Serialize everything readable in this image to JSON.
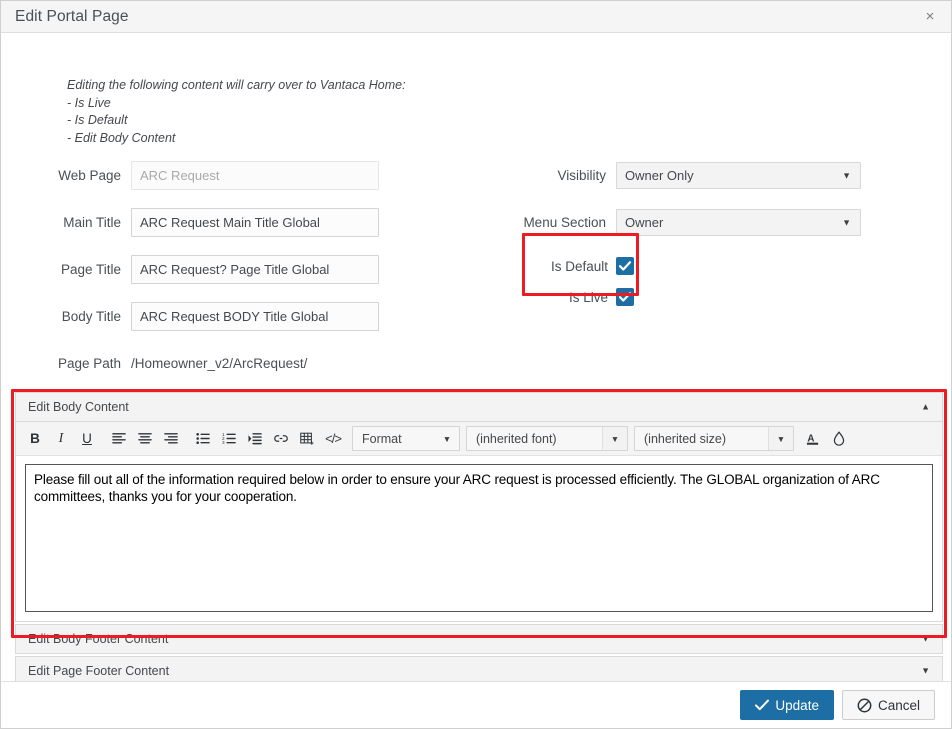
{
  "window": {
    "title": "Edit Portal Page",
    "close_label": "×"
  },
  "notes": {
    "heading": "Editing the following content will carry over to Vantaca Home:",
    "line1": "- Is Live",
    "line2": "- Is Default",
    "line3": "- Edit Body Content"
  },
  "form": {
    "web_page": {
      "label": "Web Page",
      "value": "ARC Request",
      "readonly": true
    },
    "main_title": {
      "label": "Main Title",
      "value": "ARC Request Main Title Global"
    },
    "page_title": {
      "label": "Page Title",
      "value": "ARC Request? Page Title Global"
    },
    "body_title": {
      "label": "Body Title",
      "value": "ARC Request BODY Title Global"
    },
    "page_path": {
      "label": "Page Path",
      "value": "/Homeowner_v2/ArcRequest/"
    },
    "visibility": {
      "label": "Visibility",
      "value": "Owner Only"
    },
    "menu_section": {
      "label": "Menu Section",
      "value": "Owner"
    },
    "is_default": {
      "label": "Is Default",
      "checked": true
    },
    "is_live": {
      "label": "Is Live",
      "checked": true
    }
  },
  "accordions": {
    "body_content": {
      "label": "Edit Body Content",
      "expanded": true,
      "caret": "▲"
    },
    "body_footer_content": {
      "label": "Edit Body Footer Content",
      "expanded": false,
      "caret": "▼"
    },
    "page_footer_content": {
      "label": "Edit Page Footer Content",
      "expanded": false,
      "caret": "▼"
    }
  },
  "editor": {
    "toolbar": {
      "bold": "B",
      "italic": "I",
      "underline": "U",
      "align_left": "align-left-icon",
      "align_center": "align-center-icon",
      "align_right": "align-right-icon",
      "bullet_list": "bullet-list-icon",
      "numbered_list": "numbered-list-icon",
      "indent": "indent-icon",
      "link": "link-icon",
      "table": "table-icon",
      "source_code": "</>",
      "format_select": "Format",
      "font_select": "(inherited font)",
      "size_select": "(inherited size)",
      "text_color": "A",
      "background_color": "droplet-icon",
      "caret": "▼"
    },
    "content": "Please fill out all of the information required below in order to ensure your ARC request is processed efficiently. The GLOBAL organization of ARC committees, thanks you for your cooperation."
  },
  "footer": {
    "update_label": "Update",
    "cancel_label": "Cancel"
  },
  "select_caret": "▼",
  "colors": {
    "accent_blue": "#1c6ea4",
    "annotation_red": "#ed1c24",
    "panel_gray": "#f3f3f3"
  }
}
